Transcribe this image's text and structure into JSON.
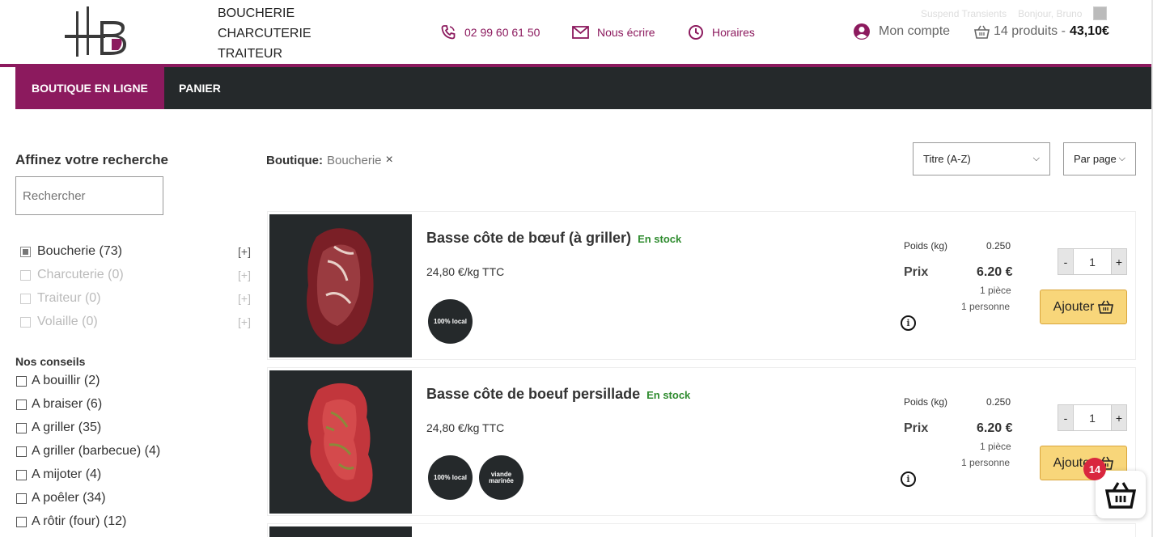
{
  "brand": {
    "line1": "BOUCHERIE",
    "line2": "CHARCUTERIE",
    "line3": "TRAITEUR"
  },
  "header": {
    "phone": "02 99 60 61 50",
    "write": "Nous écrire",
    "hours": "Horaires",
    "account": "Mon compte",
    "cart_count": "14 produits -",
    "cart_total": "43,10€",
    "admin_suspend": "Suspend Transients",
    "admin_greeting": "Bonjour, Bruno"
  },
  "nav": {
    "shop": "BOUTIQUE EN LIGNE",
    "cart": "PANIER"
  },
  "sidebar": {
    "title": "Affinez votre recherche",
    "search_placeholder": "Rechercher",
    "categories": [
      {
        "label": "Boucherie (73)",
        "plus": "[+]"
      },
      {
        "label": "Charcuterie (0)",
        "plus": "[+]"
      },
      {
        "label": "Traiteur (0)",
        "plus": "[+]"
      },
      {
        "label": "Volaille (0)",
        "plus": "[+]"
      }
    ],
    "tips_title": "Nos conseils",
    "tips": [
      "A bouillir (2)",
      "A braiser (6)",
      "A griller (35)",
      "A griller (barbecue) (4)",
      "A mijoter (4)",
      "A poêler (34)",
      "A rôtir (four) (12)"
    ]
  },
  "breadcrumb": {
    "label": "Boutique:",
    "value": "Boucherie",
    "remove": "×"
  },
  "sort": {
    "order": "Titre (A-Z)",
    "per_page": "Par page"
  },
  "products": [
    {
      "name": "Basse côte de bœuf (à griller)",
      "stock": "En stock",
      "unit_price": "24,80 €/kg TTC",
      "badges": [
        "100% local"
      ],
      "weight_label": "Poids (kg)",
      "weight": "0.250",
      "price_label": "Prix",
      "price": "6.20 €",
      "pieces": "1 pièce",
      "persons": "1 personne",
      "qty": "1",
      "add_label": "Ajouter"
    },
    {
      "name": "Basse côte de boeuf persillade",
      "stock": "En stock",
      "unit_price": "24,80 €/kg TTC",
      "badges": [
        "100% local",
        "viande marinée"
      ],
      "weight_label": "Poids (kg)",
      "weight": "0.250",
      "price_label": "Prix",
      "price": "6.20 €",
      "pieces": "1 pièce",
      "persons": "1 personne",
      "qty": "1",
      "add_label": "Ajouter"
    }
  ],
  "floating_cart": {
    "count": "14"
  },
  "colors": {
    "accent": "#8c1a5e",
    "nav_bg": "#25292b",
    "stock": "#2e8b2e",
    "add_button": "#f8d67a",
    "cart_badge": "#d9273e"
  },
  "icons": {
    "phone": "phone-icon",
    "mail": "mail-icon",
    "clock": "clock-icon",
    "account": "user-icon",
    "basket": "basket-icon",
    "info": "info-icon",
    "close": "close-icon"
  }
}
